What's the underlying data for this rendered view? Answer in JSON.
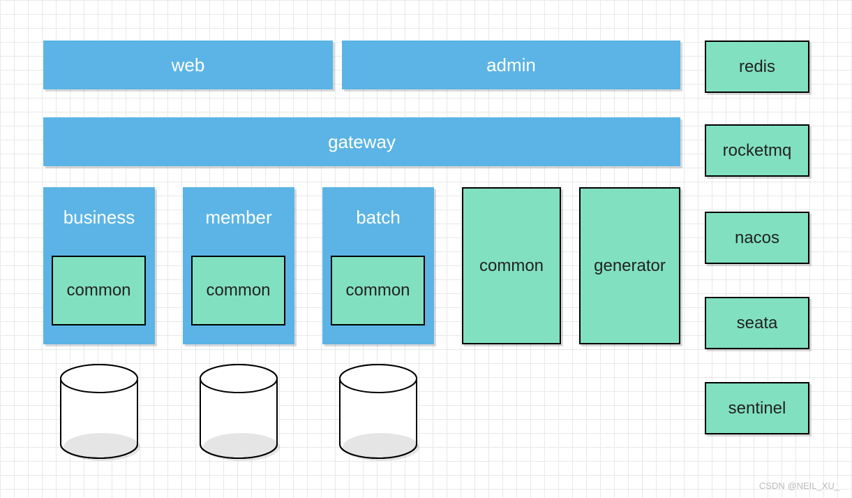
{
  "top": {
    "web": "web",
    "admin": "admin"
  },
  "gateway": "gateway",
  "services": {
    "business": {
      "title": "business",
      "inner": "common"
    },
    "member": {
      "title": "member",
      "inner": "common"
    },
    "batch": {
      "title": "batch",
      "inner": "common"
    }
  },
  "standalone": {
    "common": "common",
    "generator": "generator"
  },
  "sidebar": {
    "redis": "redis",
    "rocketmq": "rocketmq",
    "nacos": "nacos",
    "seata": "seata",
    "sentinel": "sentinel"
  },
  "watermark": "CSDN @NEIL_XU_"
}
